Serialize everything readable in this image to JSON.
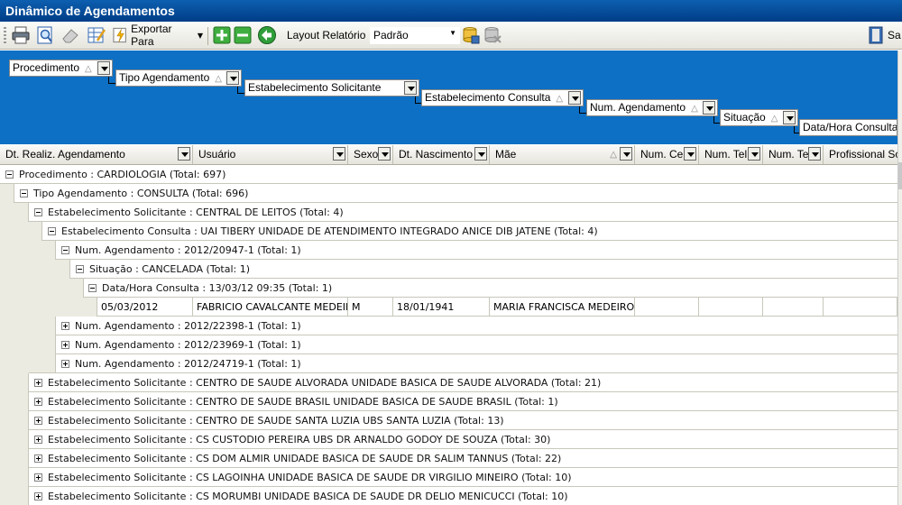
{
  "window": {
    "title": "Dinâmico de Agendamentos"
  },
  "toolbar": {
    "export_label": "Exportar Para",
    "layout_label": "Layout Relatório",
    "layout_value": "Padrão",
    "right_button_label": "Sa"
  },
  "group_fields": [
    "Procedimento",
    "Tipo Agendamento",
    "Estabelecimento Solicitante",
    "Estabelecimento Consulta",
    "Num. Agendamento",
    "Situação",
    "Data/Hora Consulta"
  ],
  "columns": [
    "Dt. Realiz. Agendamento",
    "Usuário",
    "Sexo",
    "Dt. Nascimento",
    "Mãe",
    "Num. Cel",
    "Num. Tel",
    "Num. Te",
    "Profissional Sc"
  ],
  "rows": [
    {
      "label": "Procedimento : CARDIOLOGIA (Total: 697)"
    },
    {
      "label": "Tipo Agendamento : CONSULTA  (Total: 696)"
    },
    {
      "label": "Estabelecimento Solicitante : CENTRAL DE LEITOS (Total: 4)"
    },
    {
      "label": "Estabelecimento Consulta : UAI TIBERY UNIDADE DE ATENDIMENTO INTEGRADO ANICE DIB JATENE (Total: 4)"
    },
    {
      "label": "Num. Agendamento : 2012/20947-1 (Total: 1)"
    },
    {
      "label": "Situação : CANCELADA (Total: 1)"
    },
    {
      "label": "Data/Hora Consulta : 13/03/12 09:35 (Total: 1)"
    },
    {
      "cells": [
        "05/03/2012",
        "FABRICIO CAVALCANTE MEDEIROS",
        "M",
        "18/01/1941",
        "MARIA FRANCISCA  MEDEIROS",
        "",
        "",
        "",
        ""
      ]
    },
    {
      "label": "Num. Agendamento : 2012/22398-1 (Total: 1)"
    },
    {
      "label": "Num. Agendamento : 2012/23969-1 (Total: 1)"
    },
    {
      "label": "Num. Agendamento : 2012/24719-1 (Total: 1)"
    },
    {
      "label": "Estabelecimento Solicitante : CENTRO DE SAUDE ALVORADA UNIDADE BASICA DE SAUDE ALVORADA (Total: 21)"
    },
    {
      "label": "Estabelecimento Solicitante : CENTRO DE SAUDE BRASIL UNIDADE BASICA DE SAUDE BRASIL (Total: 1)"
    },
    {
      "label": "Estabelecimento Solicitante : CENTRO DE SAUDE SANTA LUZIA UBS SANTA LUZIA (Total: 13)"
    },
    {
      "label": "Estabelecimento Solicitante : CS CUSTODIO PEREIRA UBS DR ARNALDO GODOY DE SOUZA (Total: 30)"
    },
    {
      "label": "Estabelecimento Solicitante : CS DOM ALMIR UNIDADE BASICA DE SAUDE DR SALIM TANNUS (Total: 22)"
    },
    {
      "label": "Estabelecimento Solicitante : CS LAGOINHA UNIDADE BASICA DE SAUDE DR VIRGILIO MINEIRO (Total: 10)"
    },
    {
      "label": "Estabelecimento Solicitante : CS MORUMBI UNIDADE BASICA DE SAUDE DR DELIO MENICUCCI (Total: 10)"
    }
  ]
}
